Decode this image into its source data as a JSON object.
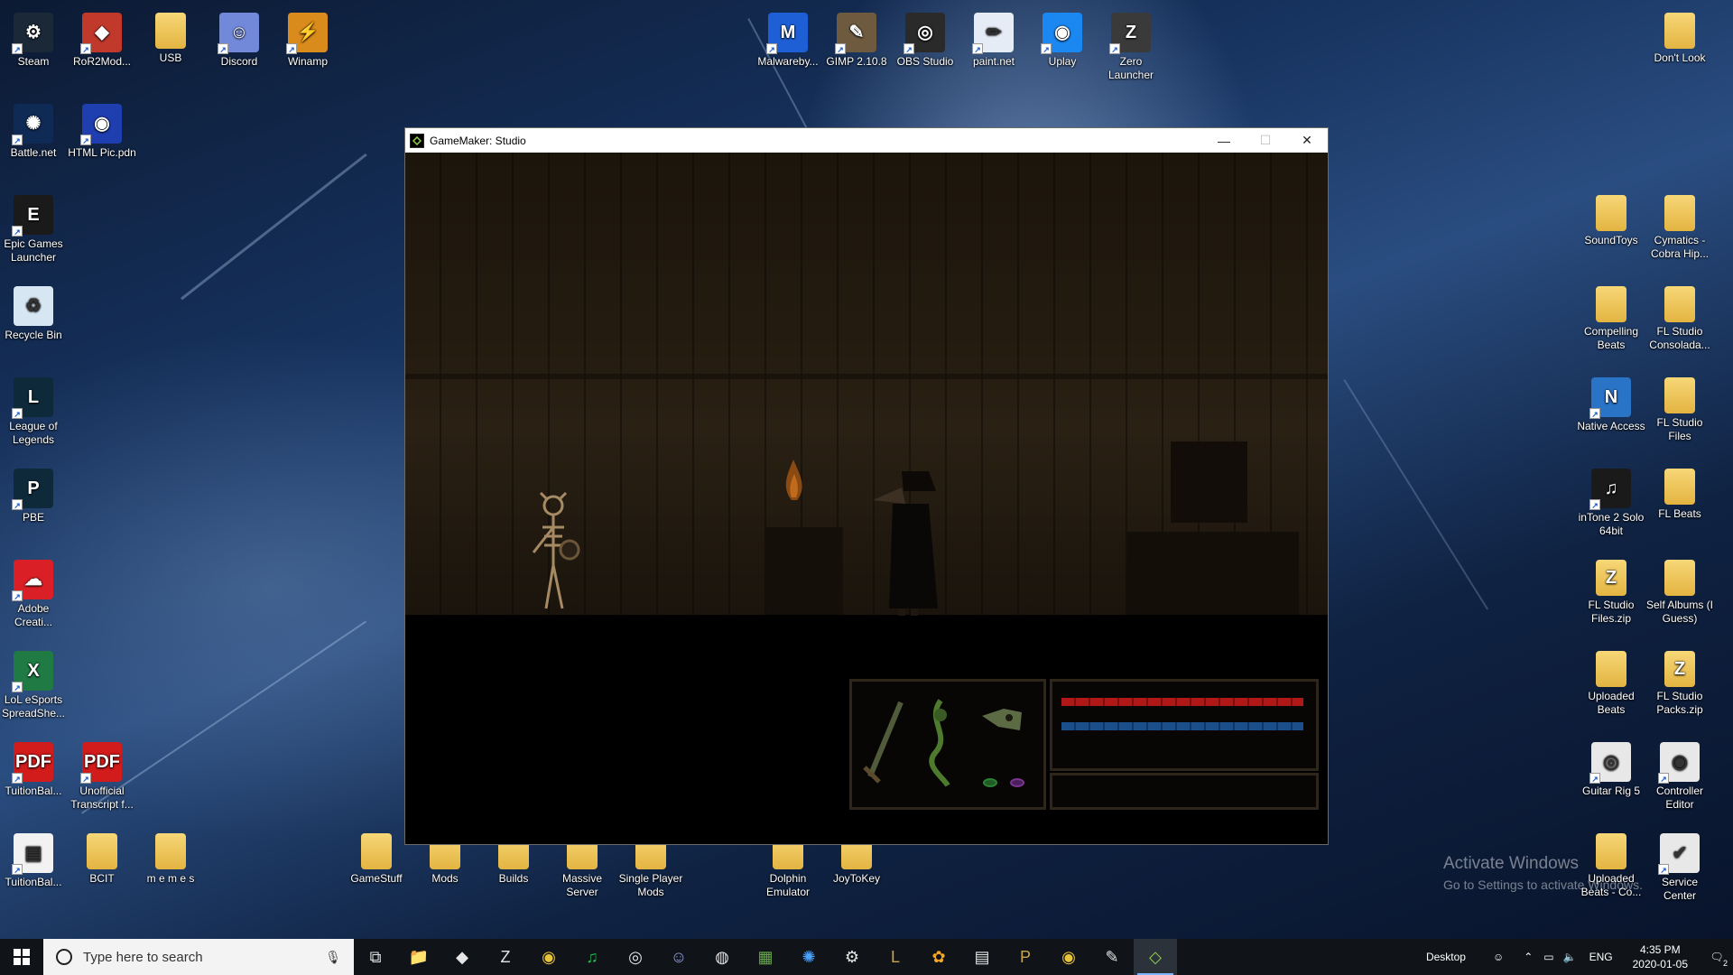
{
  "desktop": {
    "left_col1": [
      {
        "label": "Steam",
        "icon": "steam-icon"
      },
      {
        "label": "Battle.net",
        "icon": "battlenet-icon"
      },
      {
        "label": "Epic Games Launcher",
        "icon": "epic-games-icon"
      },
      {
        "label": "Recycle Bin",
        "icon": "recycle-bin-icon"
      },
      {
        "label": "League of Legends",
        "icon": "league-icon"
      },
      {
        "label": "PBE",
        "icon": "pbe-icon"
      },
      {
        "label": "Adobe Creati...",
        "icon": "adobe-cc-icon"
      },
      {
        "label": "LoL eSports SpreadShe...",
        "icon": "excel-icon"
      },
      {
        "label": "TuitionBal...",
        "icon": "pdf-icon"
      },
      {
        "label": "TuitionBal...",
        "icon": "document-icon"
      }
    ],
    "left_col2": [
      {
        "label": "RoR2Mod...",
        "icon": "ror2mod-icon"
      },
      {
        "label": "HTML Pic.pdn",
        "icon": "paintnet-file-icon"
      },
      {
        "label": "Unofficial Transcript f...",
        "icon": "pdf-icon"
      },
      {
        "label": "BCIT",
        "icon": "folder-icon"
      }
    ],
    "top_row": [
      {
        "label": "USB",
        "icon": "folder-icon"
      },
      {
        "label": "Discord",
        "icon": "discord-icon"
      },
      {
        "label": "Winamp",
        "icon": "winamp-icon"
      },
      {
        "label": "Malwareby...",
        "icon": "malwarebytes-icon"
      },
      {
        "label": "GIMP 2.10.8",
        "icon": "gimp-icon"
      },
      {
        "label": "OBS Studio",
        "icon": "obs-icon"
      },
      {
        "label": "paint.net",
        "icon": "paintnet-icon"
      },
      {
        "label": "Uplay",
        "icon": "uplay-icon"
      },
      {
        "label": "Zero Launcher",
        "icon": "zero-launcher-icon"
      },
      {
        "label": "Don't Look",
        "icon": "folder-icon"
      }
    ],
    "bottom_row": [
      {
        "label": "m e m e s",
        "icon": "folder-icon"
      },
      {
        "label": "GameStuff",
        "icon": "folder-icon"
      },
      {
        "label": "Mods",
        "icon": "folder-icon"
      },
      {
        "label": "Builds",
        "icon": "folder-icon"
      },
      {
        "label": "Massive Server",
        "icon": "folder-icon"
      },
      {
        "label": "Single Player Mods",
        "icon": "folder-icon"
      },
      {
        "label": "Dolphin Emulator",
        "icon": "folder-icon"
      },
      {
        "label": "JoyToKey",
        "icon": "folder-icon"
      }
    ],
    "right_col1": [
      {
        "label": "SoundToys",
        "icon": "folder-icon"
      },
      {
        "label": "Compelling Beats",
        "icon": "folder-icon"
      },
      {
        "label": "Native Access",
        "icon": "native-access-icon"
      },
      {
        "label": "inTone 2 Solo 64bit",
        "icon": "intone-icon"
      },
      {
        "label": "FL Studio Files.zip",
        "icon": "zip-folder-icon"
      },
      {
        "label": "Uploaded Beats",
        "icon": "folder-icon"
      },
      {
        "label": "Guitar Rig 5",
        "icon": "guitar-rig-icon"
      },
      {
        "label": "Uploaded Beats - Co...",
        "icon": "folder-icon"
      }
    ],
    "right_col2": [
      {
        "label": "Cymatics - Cobra Hip...",
        "icon": "folder-icon"
      },
      {
        "label": "FL Studio Consolada...",
        "icon": "folder-icon"
      },
      {
        "label": "FL Studio Files",
        "icon": "folder-icon"
      },
      {
        "label": "FL Beats",
        "icon": "folder-icon"
      },
      {
        "label": "Self Albums (I Guess)",
        "icon": "folder-icon"
      },
      {
        "label": "FL Studio Packs.zip",
        "icon": "zip-folder-icon"
      },
      {
        "label": "Controller Editor",
        "icon": "controller-editor-icon"
      },
      {
        "label": "Service Center",
        "icon": "service-center-icon"
      }
    ]
  },
  "window": {
    "title": "GameMaker: Studio",
    "minimize": "—",
    "maximize": "☐",
    "close": "✕"
  },
  "game": {
    "health_fraction": 1.0,
    "mana_fraction": 1.0,
    "health_color": "#b01818",
    "mana_color": "#1a4f8c"
  },
  "watermark": {
    "title": "Activate Windows",
    "subtitle": "Go to Settings to activate Windows."
  },
  "taskbar": {
    "search_placeholder": "Type here to search",
    "apps": [
      "task-view-icon",
      "file-explorer-icon",
      "ror2-icon",
      "zero-launcher-icon",
      "chrome-icon",
      "spotify-icon",
      "uplay-icon",
      "discord-icon",
      "obs-icon",
      "minecraft-icon",
      "battlenet-icon",
      "steam-icon",
      "league-icon",
      "fl-studio-icon",
      "notepad-icon",
      "pbe-icon",
      "chrome-icon",
      "gimp-icon",
      "gamemaker-icon"
    ],
    "desktop_label": "Desktop",
    "language": "ENG",
    "time": "4:35 PM",
    "date": "2020-01-05",
    "notification_count": "2"
  }
}
